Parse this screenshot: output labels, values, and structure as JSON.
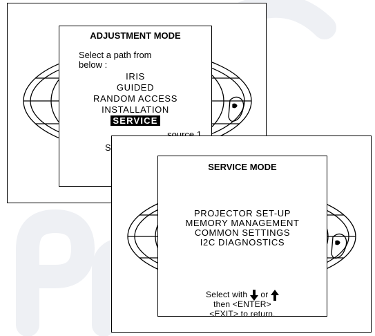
{
  "window1": {
    "title": "ADJUSTMENT MODE",
    "prompt_line1": "Select a path from",
    "prompt_line2": "below :",
    "options": [
      "IRIS",
      "GUIDED",
      "RANDOM ACCESS",
      "INSTALLATION"
    ],
    "selected": "SERVICE",
    "source": "source 1",
    "partial_text": "S"
  },
  "window2": {
    "title": "SERVICE MODE",
    "items": [
      "PROJECTOR SET-UP",
      "MEMORY MANAGEMENT",
      "COMMON SETTINGS",
      "I2C DIAGNOSTICS"
    ],
    "footer_prefix": "Select with",
    "footer_or": "or",
    "footer_line2": "then <ENTER>",
    "footer_line3": "<EXIT> to return.",
    "icons": [
      "arrow-down-icon",
      "arrow-up-icon"
    ]
  }
}
